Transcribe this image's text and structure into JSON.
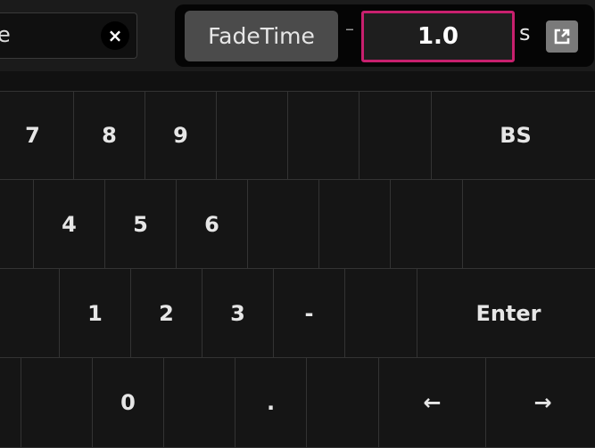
{
  "search": {
    "value": "e",
    "clear_label": "×"
  },
  "parameter": {
    "name": "FadeTime",
    "minus_label": "–",
    "value": "1.0",
    "unit": "s"
  },
  "keypad": {
    "row1": {
      "k7": "7",
      "k8": "8",
      "k9": "9",
      "bs": "BS"
    },
    "row2": {
      "k4": "4",
      "k5": "5",
      "k6": "6"
    },
    "row3": {
      "k1": "1",
      "k2": "2",
      "k3": "3",
      "minus": "-",
      "enter": "Enter"
    },
    "row4": {
      "k0": "0",
      "dot": ".",
      "left": "←",
      "right": "→"
    }
  },
  "colors": {
    "accent": "#c8206e",
    "background": "#111111",
    "key_border": "#333333"
  },
  "icons": {
    "clear": "close-icon",
    "link": "external-link-icon"
  }
}
